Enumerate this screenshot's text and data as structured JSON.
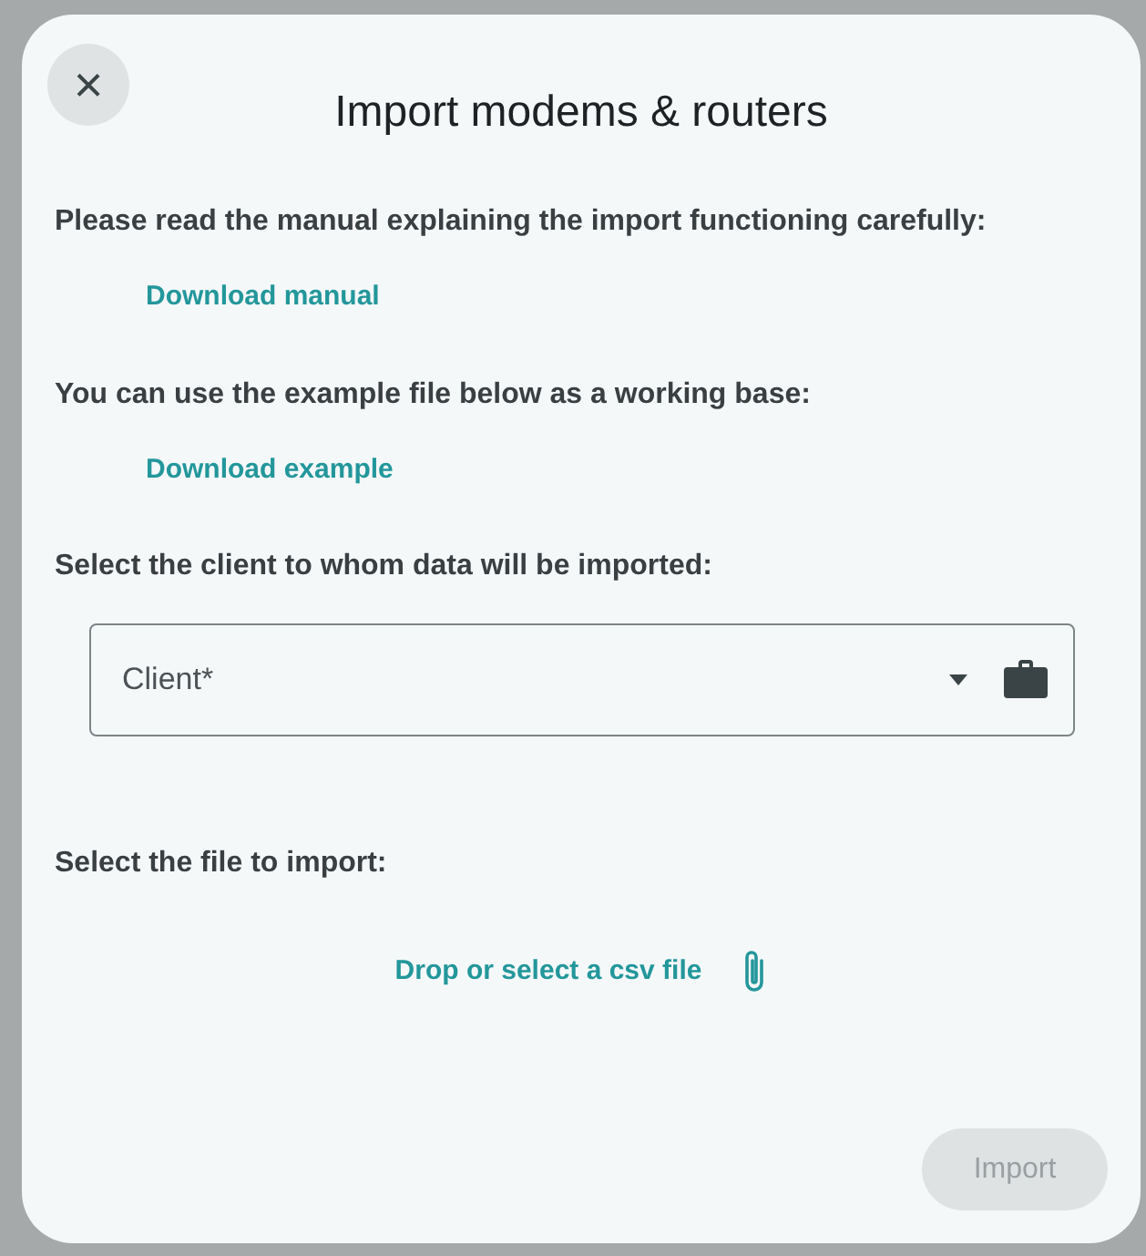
{
  "dialog": {
    "title": "Import modems & routers",
    "close_label": "×",
    "sections": [
      {
        "kind": "link",
        "heading": "Please read the manual explaining the import functioning carefully:",
        "link": "Download manual"
      },
      {
        "kind": "link",
        "heading": "You can use the example file below as a working base:",
        "link": "Download example"
      },
      {
        "kind": "select",
        "heading": "Select the client to whom data will be imported:",
        "placeholder": "Client*"
      },
      {
        "kind": "file",
        "heading": "Select the file to import:",
        "link": "Drop or select a csv file"
      }
    ],
    "import_button": {
      "label": "Import",
      "disabled": true
    }
  }
}
